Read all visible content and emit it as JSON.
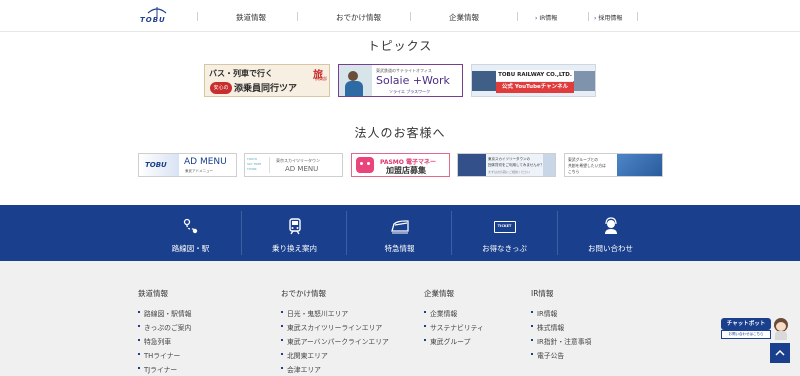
{
  "header": {
    "logo_text": "TOBU",
    "nav": [
      {
        "label": "鉄道情報"
      },
      {
        "label": "おでかけ情報"
      },
      {
        "label": "企業情報"
      },
      {
        "label": "IR情報"
      },
      {
        "label": "採用情報"
      }
    ]
  },
  "topics": {
    "title": "トピックス",
    "banners": [
      {
        "line1": "バス・列車で行く",
        "badge": "安心の",
        "line2": "添乗員同行ツア",
        "accent": "旅",
        "accent_sub": "倶楽部"
      },
      {
        "pre": "東武鉄道のサテライトオフィス",
        "main": "Solaie +Work",
        "sub": "ソライエ プラスワーク"
      },
      {
        "line1": "TOBU RAILWAY CO.,LTD.",
        "line2": "公式 YouTubeチャンネル"
      }
    ]
  },
  "corporate": {
    "title": "法人のお客様へ",
    "banners": [
      {
        "brand": "TOBU",
        "main": "AD MENU",
        "sub": "東武アドメニュー"
      },
      {
        "logo1": "TOKYO",
        "logo2": "SKY TREE",
        "logo3": "TOWN.",
        "pre": "東京スカイツリータウン",
        "main": "AD MENU"
      },
      {
        "line1": "PASMO 電子マネー",
        "line2": "加盟店募集"
      },
      {
        "line1": "東京スカイツリータウンの",
        "line2": "団体貸切をご利用してみませんか？",
        "line3": "まずはお気軽にご相談ください"
      },
      {
        "line1": "東武グループとの",
        "line2": "共創を希望したい方は",
        "line3": "こちら"
      }
    ]
  },
  "quicknav": [
    {
      "label": "路線図・駅",
      "icon": "route-map-icon"
    },
    {
      "label": "乗り換え案内",
      "icon": "train-icon"
    },
    {
      "label": "特急情報",
      "icon": "limited-express-icon"
    },
    {
      "label": "お得なきっぷ",
      "icon": "ticket-icon",
      "icon_text": "TICKET"
    },
    {
      "label": "お問い合わせ",
      "icon": "operator-icon"
    }
  ],
  "footer": {
    "columns": [
      {
        "heading": "鉄道情報",
        "links": [
          "路線図・駅情報",
          "きっぷのご案内",
          "特急列車",
          "THライナー",
          "TJライナー"
        ]
      },
      {
        "heading": "おでかけ情報",
        "links": [
          "日光・鬼怒川エリア",
          "東武スカイツリーラインエリア",
          "東武アーバンパークラインエリア",
          "北関東エリア",
          "会津エリア"
        ]
      },
      {
        "heading": "企業情報",
        "links": [
          "企業情報",
          "サステナビリティ",
          "東武グループ"
        ]
      },
      {
        "heading": "IR情報",
        "links": [
          "IR情報",
          "株式情報",
          "IR指針・注意事項",
          "電子公告"
        ]
      }
    ]
  },
  "chatbot": {
    "title": "チャットボット",
    "sub": "お問い合わせはこちら"
  },
  "colors": {
    "brand_blue": "#1a3f8d",
    "footer_bg": "#f0f0f0"
  }
}
